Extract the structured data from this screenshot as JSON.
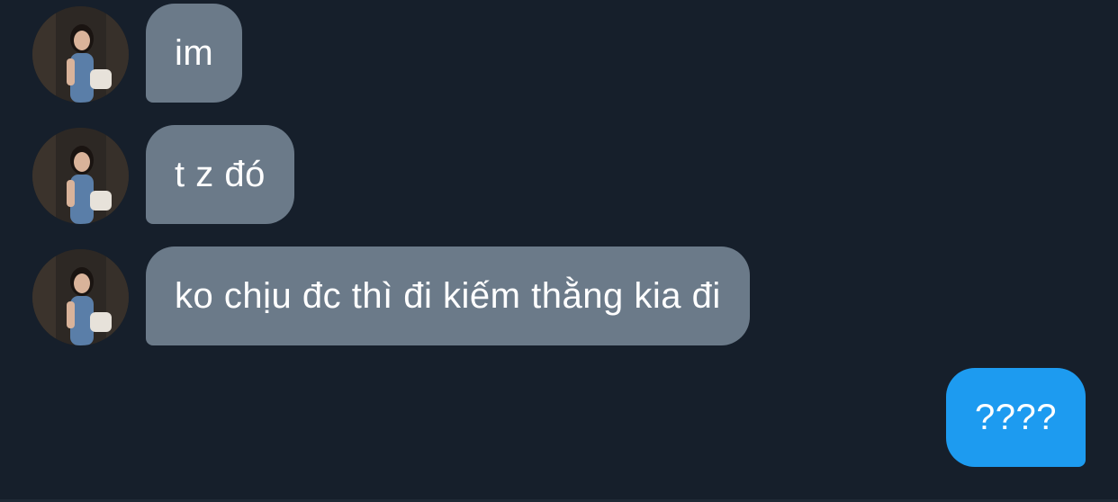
{
  "messages": [
    {
      "direction": "received",
      "text": "im",
      "avatar": "contact-avatar"
    },
    {
      "direction": "received",
      "text": "t z đó",
      "avatar": "contact-avatar"
    },
    {
      "direction": "received",
      "text": "ko chịu đc thì đi kiếm thằng kia đi",
      "avatar": "contact-avatar"
    },
    {
      "direction": "sent",
      "text": "????"
    }
  ],
  "colors": {
    "background": "#161f2b",
    "received_bubble": "#6b7a89",
    "sent_bubble": "#1d9bf0",
    "text": "#ffffff"
  }
}
